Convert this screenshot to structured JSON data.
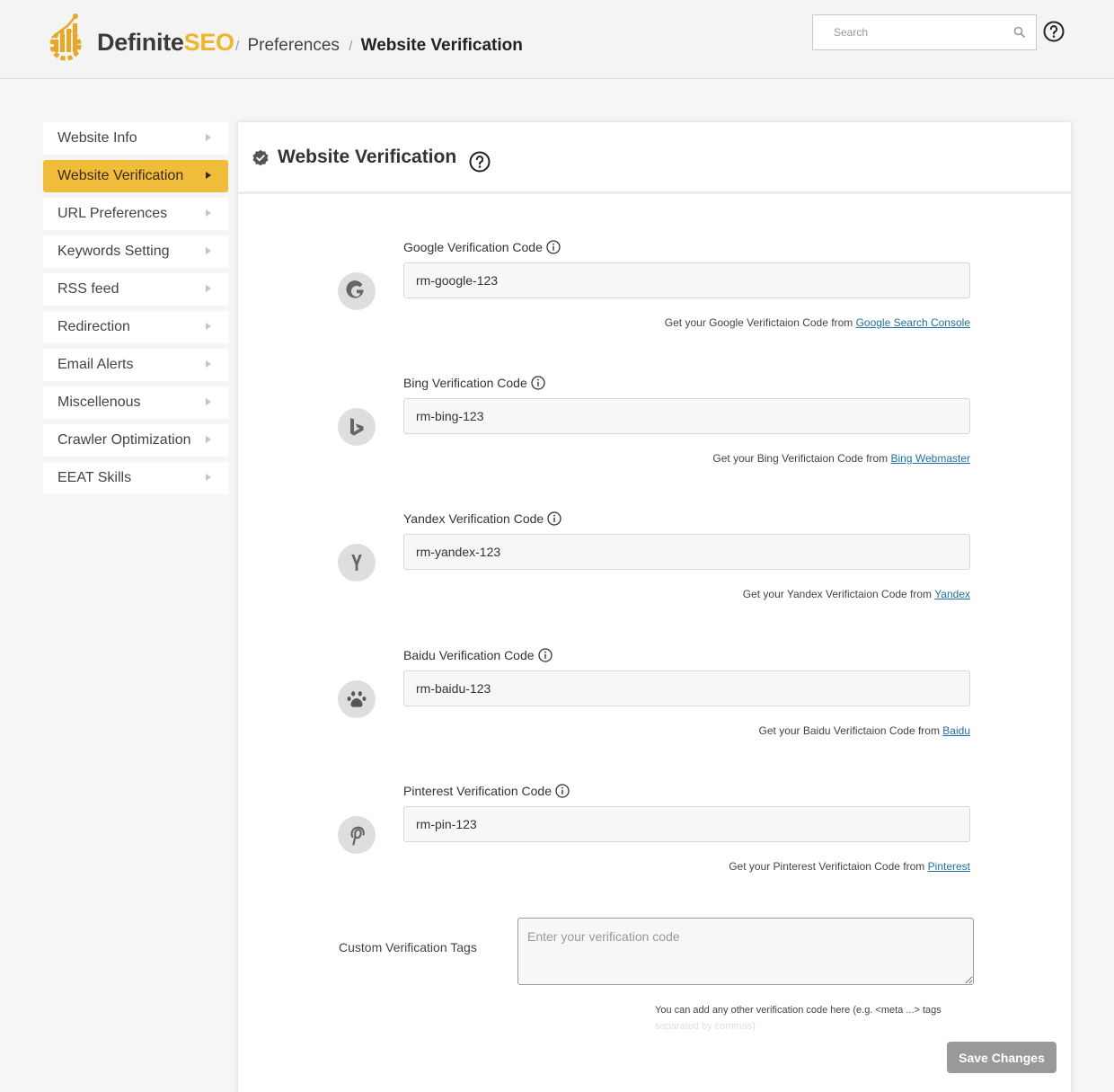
{
  "brand": {
    "part1": "Definite",
    "part2": "SEO"
  },
  "breadcrumb": {
    "sep1": "/",
    "item1": "Preferences",
    "sep2": "/",
    "item2": "Website Verification"
  },
  "search": {
    "placeholder": "Search"
  },
  "sidebar": {
    "items": [
      {
        "label": "Website Info",
        "active": false
      },
      {
        "label": "Website Verification",
        "active": true
      },
      {
        "label": "URL Preferences",
        "active": false
      },
      {
        "label": "Keywords Setting",
        "active": false
      },
      {
        "label": "RSS feed",
        "active": false
      },
      {
        "label": "Redirection",
        "active": false
      },
      {
        "label": "Email Alerts",
        "active": false
      },
      {
        "label": "Miscellenous",
        "active": false
      },
      {
        "label": "Crawler Optimization",
        "active": false
      },
      {
        "label": "EEAT Skills",
        "active": false
      }
    ]
  },
  "panel": {
    "title": "Website Verification",
    "fields": [
      {
        "icon": "google-icon",
        "label": "Google Verification Code",
        "value": "rm-google-123",
        "hint": "Get your Google Verifictaion Code from",
        "link": "Google Search Console"
      },
      {
        "icon": "bing-icon",
        "label": "Bing Verification Code",
        "value": "rm-bing-123",
        "hint": "Get your Bing Verifictaion Code from",
        "link": "Bing Webmaster"
      },
      {
        "icon": "yandex-icon",
        "label": "Yandex Verification Code",
        "value": "rm-yandex-123",
        "hint": "Get your Yandex Verifictaion Code from",
        "link": "Yandex"
      },
      {
        "icon": "baidu-icon",
        "label": "Baidu Verification Code",
        "value": "rm-baidu-123",
        "hint": "Get your Baidu Verifictaion Code from",
        "link": "Baidu"
      },
      {
        "icon": "pinterest-icon",
        "label": "Pinterest Verification Code",
        "value": "rm-pin-123",
        "hint": "Get your Pinterest Verifictaion Code from",
        "link": "Pinterest"
      }
    ],
    "custom": {
      "label": "Custom Verification Tags",
      "placeholder": "Enter your verification code",
      "hint": "You can add any other verification code here (e.g. <meta ...> tags",
      "hint2": "separated by commas)"
    },
    "save_label": "Save Changes"
  },
  "colors": {
    "accent": "#efbd3a",
    "brand_orange": "#f0b52b",
    "link": "#1f6fa8",
    "button_disabled": "#999999"
  }
}
